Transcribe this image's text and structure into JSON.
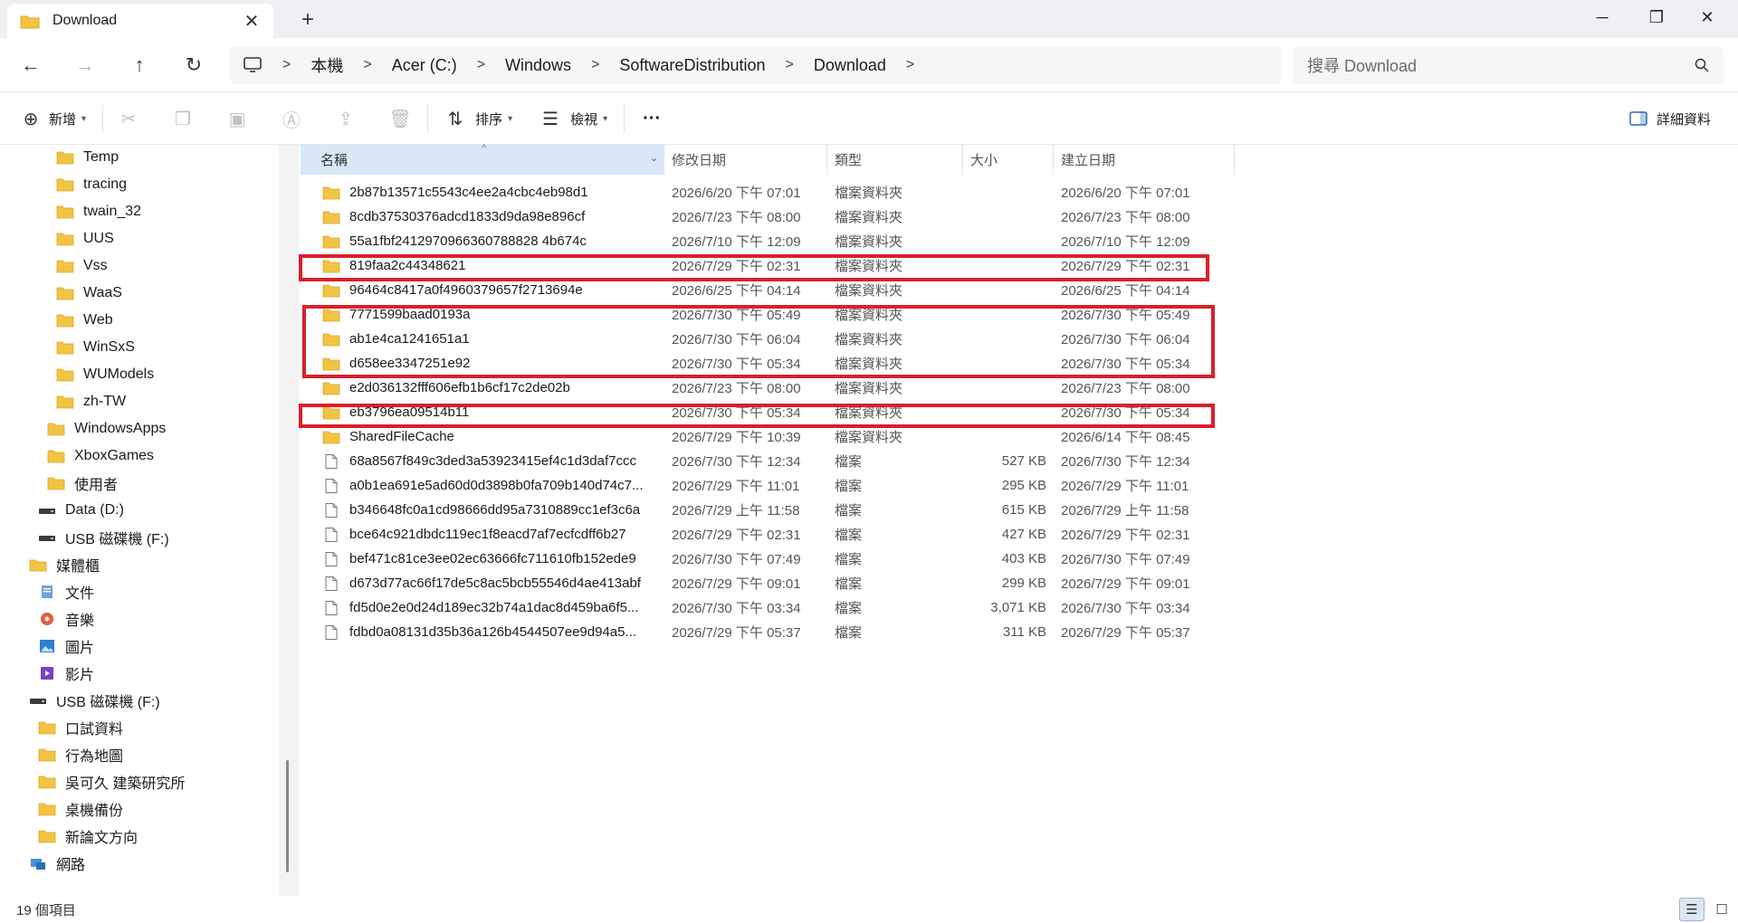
{
  "window": {
    "tab_title": "Download",
    "tab_close": "✕",
    "new_tab": "+",
    "minimize": "─",
    "maximize": "❐",
    "close": "✕"
  },
  "address": {
    "crumbs": [
      "本機",
      "Acer (C:)",
      "Windows",
      "SoftwareDistribution",
      "Download"
    ],
    "search_placeholder": "搜尋 Download"
  },
  "toolbar": {
    "new_label": "新增",
    "sort_label": "排序",
    "view_label": "檢視",
    "more_label": "···",
    "details_label": "詳細資料"
  },
  "nav_pane": {
    "items": [
      {
        "label": "Temp",
        "icon": "folder-icon"
      },
      {
        "label": "tracing",
        "icon": "folder-icon"
      },
      {
        "label": "twain_32",
        "icon": "folder-icon"
      },
      {
        "label": "UUS",
        "icon": "folder-icon"
      },
      {
        "label": "Vss",
        "icon": "folder-icon"
      },
      {
        "label": "WaaS",
        "icon": "folder-icon"
      },
      {
        "label": "Web",
        "icon": "folder-icon"
      },
      {
        "label": "WinSxS",
        "icon": "folder-icon"
      },
      {
        "label": "WUModels",
        "icon": "folder-icon"
      },
      {
        "label": "zh-TW",
        "icon": "folder-icon"
      },
      {
        "label": "WindowsApps",
        "icon": "folder-icon"
      },
      {
        "label": "XboxGames",
        "icon": "folder-icon"
      },
      {
        "label": "使用者",
        "icon": "folder-icon"
      },
      {
        "label": "Data (D:)",
        "icon": "drive-icon"
      },
      {
        "label": "USB 磁碟機 (F:)",
        "icon": "drive-icon"
      },
      {
        "label": "媒體櫃",
        "icon": "library-icon"
      },
      {
        "label": "文件",
        "icon": "documents-icon"
      },
      {
        "label": "音樂",
        "icon": "music-icon"
      },
      {
        "label": "圖片",
        "icon": "pictures-icon"
      },
      {
        "label": "影片",
        "icon": "videos-icon"
      },
      {
        "label": "USB 磁碟機 (F:)",
        "icon": "drive-icon"
      },
      {
        "label": "口試資料",
        "icon": "folder-icon"
      },
      {
        "label": "行為地圖",
        "icon": "folder-icon"
      },
      {
        "label": "吳可久 建築研究所",
        "icon": "folder-icon"
      },
      {
        "label": "桌機備份",
        "icon": "folder-icon"
      },
      {
        "label": "新論文方向",
        "icon": "folder-icon"
      },
      {
        "label": "網路",
        "icon": "network-icon"
      }
    ]
  },
  "columns": {
    "name": "名稱",
    "modified": "修改日期",
    "type": "類型",
    "size": "大小",
    "created": "建立日期"
  },
  "files": [
    {
      "name": "2b87b13571c5543c4ee2a4cbc4eb98d1",
      "modified": "2026/6/20 下午 07:01",
      "type": "檔案資料夾",
      "size": "",
      "created": "2026/6/20 下午 07:01",
      "kind": "folder"
    },
    {
      "name": "8cdb37530376adcd1833d9da98e896cf",
      "modified": "2026/7/23 下午 08:00",
      "type": "檔案資料夾",
      "size": "",
      "created": "2026/7/23 下午 08:00",
      "kind": "folder"
    },
    {
      "name": "55a1fbf2412970966360788828 4b674c",
      "modified": "2026/7/10 下午 12:09",
      "type": "檔案資料夾",
      "size": "",
      "created": "2026/7/10 下午 12:09",
      "kind": "folder"
    },
    {
      "name": "819faa2c44348621",
      "modified": "2026/7/29 下午 02:31",
      "type": "檔案資料夾",
      "size": "",
      "created": "2026/7/29 下午 02:31",
      "kind": "folder"
    },
    {
      "name": "96464c8417a0f4960379657f2713694e",
      "modified": "2026/6/25 下午 04:14",
      "type": "檔案資料夾",
      "size": "",
      "created": "2026/6/25 下午 04:14",
      "kind": "folder"
    },
    {
      "name": "7771599baad0193a",
      "modified": "2026/7/30 下午 05:49",
      "type": "檔案資料夾",
      "size": "",
      "created": "2026/7/30 下午 05:49",
      "kind": "folder"
    },
    {
      "name": "ab1e4ca1241651a1",
      "modified": "2026/7/30 下午 06:04",
      "type": "檔案資料夾",
      "size": "",
      "created": "2026/7/30 下午 06:04",
      "kind": "folder"
    },
    {
      "name": "d658ee3347251e92",
      "modified": "2026/7/30 下午 05:34",
      "type": "檔案資料夾",
      "size": "",
      "created": "2026/7/30 下午 05:34",
      "kind": "folder"
    },
    {
      "name": "e2d036132fff606efb1b6cf17c2de02b",
      "modified": "2026/7/23 下午 08:00",
      "type": "檔案資料夾",
      "size": "",
      "created": "2026/7/23 下午 08:00",
      "kind": "folder"
    },
    {
      "name": "eb3796ea09514b11",
      "modified": "2026/7/30 下午 05:34",
      "type": "檔案資料夾",
      "size": "",
      "created": "2026/7/30 下午 05:34",
      "kind": "folder"
    },
    {
      "name": "SharedFileCache",
      "modified": "2026/7/29 下午 10:39",
      "type": "檔案資料夾",
      "size": "",
      "created": "2026/6/14 下午 08:45",
      "kind": "folder"
    },
    {
      "name": "68a8567f849c3ded3a53923415ef4c1d3daf7ccc",
      "modified": "2026/7/30 下午 12:34",
      "type": "檔案",
      "size": "527 KB",
      "created": "2026/7/30 下午 12:34",
      "kind": "file"
    },
    {
      "name": "a0b1ea691e5ad60d0d3898b0fa709b140d74c7...",
      "modified": "2026/7/29 下午 11:01",
      "type": "檔案",
      "size": "295 KB",
      "created": "2026/7/29 下午 11:01",
      "kind": "file"
    },
    {
      "name": "b346648fc0a1cd98666dd95a7310889cc1ef3c6a",
      "modified": "2026/7/29 上午 11:58",
      "type": "檔案",
      "size": "615 KB",
      "created": "2026/7/29 上午 11:58",
      "kind": "file"
    },
    {
      "name": "bce64c921dbdc119ec1f8eacd7af7ecfcdff6b27",
      "modified": "2026/7/29 下午 02:31",
      "type": "檔案",
      "size": "427 KB",
      "created": "2026/7/29 下午 02:31",
      "kind": "file"
    },
    {
      "name": "bef471c81ce3ee02ec63666fc711610fb152ede9",
      "modified": "2026/7/30 下午 07:49",
      "type": "檔案",
      "size": "403 KB",
      "created": "2026/7/30 下午 07:49",
      "kind": "file"
    },
    {
      "name": "d673d77ac66f17de5c8ac5bcb55546d4ae413abf",
      "modified": "2026/7/29 下午 09:01",
      "type": "檔案",
      "size": "299 KB",
      "created": "2026/7/29 下午 09:01",
      "kind": "file"
    },
    {
      "name": "fd5d0e2e0d24d189ec32b74a1dac8d459ba6f5...",
      "modified": "2026/7/30 下午 03:34",
      "type": "檔案",
      "size": "3,071 KB",
      "created": "2026/7/30 下午 03:34",
      "kind": "file"
    },
    {
      "name": "fdbd0a08131d35b36a126b4544507ee9d94a5...",
      "modified": "2026/7/29 下午 05:37",
      "type": "檔案",
      "size": "311 KB",
      "created": "2026/7/29 下午 05:37",
      "kind": "file"
    }
  ],
  "status": {
    "item_count": "19 個項目"
  },
  "colors": {
    "folder": "#f3c443",
    "highlight": "#d9202a",
    "header_selected": "#d8e8f8"
  }
}
